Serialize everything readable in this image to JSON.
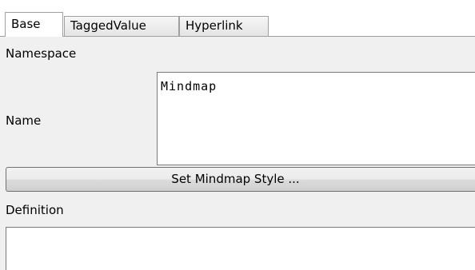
{
  "tabs": [
    {
      "label": "Base",
      "active": true
    },
    {
      "label": "TaggedValue",
      "active": false
    },
    {
      "label": "Hyperlink",
      "active": false
    }
  ],
  "fields": {
    "namespace_label": "Namespace",
    "name_label": "Name",
    "name_value": "Mindmap",
    "set_style_button": "Set Mindmap Style ...",
    "definition_label": "Definition",
    "definition_value": ""
  }
}
